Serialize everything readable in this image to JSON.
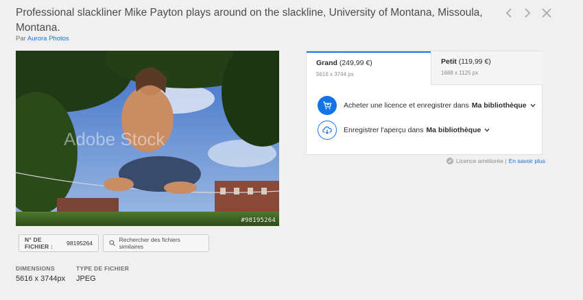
{
  "header": {
    "title": "Professional slackliner Mike Payton plays around on the slackline, University of Montana, Missoula, Montana.",
    "by_prefix": "Par",
    "author": "Aurora Photos"
  },
  "nav": {
    "prev_icon": "chevron-left-icon",
    "next_icon": "chevron-right-icon",
    "close_icon": "close-icon"
  },
  "image": {
    "overlay_id": "#98195264",
    "watermark": "Adobe Stock"
  },
  "file_bar": {
    "file_label": "N° DE FICHIER :",
    "file_value": "98195264",
    "similar_label": "Rechercher des fichiers similaires"
  },
  "meta": {
    "dimensions_label": "DIMENSIONS",
    "dimensions_value": "5616 x 3744px",
    "type_label": "TYPE DE FICHIER",
    "type_value": "JPEG"
  },
  "licence_panel": {
    "tabs": [
      {
        "name": "Grand",
        "price": "(249,99 €)",
        "size": "5616 x 3744 px",
        "selected": true
      },
      {
        "name": "Petit",
        "price": "(119,99 €)",
        "size": "1688 x 1125 px",
        "selected": false
      }
    ],
    "actions": [
      {
        "label": "Acheter une licence et enregistrer dans",
        "library": "Ma bibliothèque",
        "icon": "cart-icon"
      },
      {
        "label": "Enregistrer l'aperçu dans",
        "library": "Ma bibliothèque",
        "icon": "cloud-download-icon"
      }
    ]
  },
  "licence_note": {
    "text": "Licence améliorée |",
    "link": "En savoir plus"
  },
  "colors": {
    "accent": "#1473e6",
    "background": "#f0f0f0"
  }
}
